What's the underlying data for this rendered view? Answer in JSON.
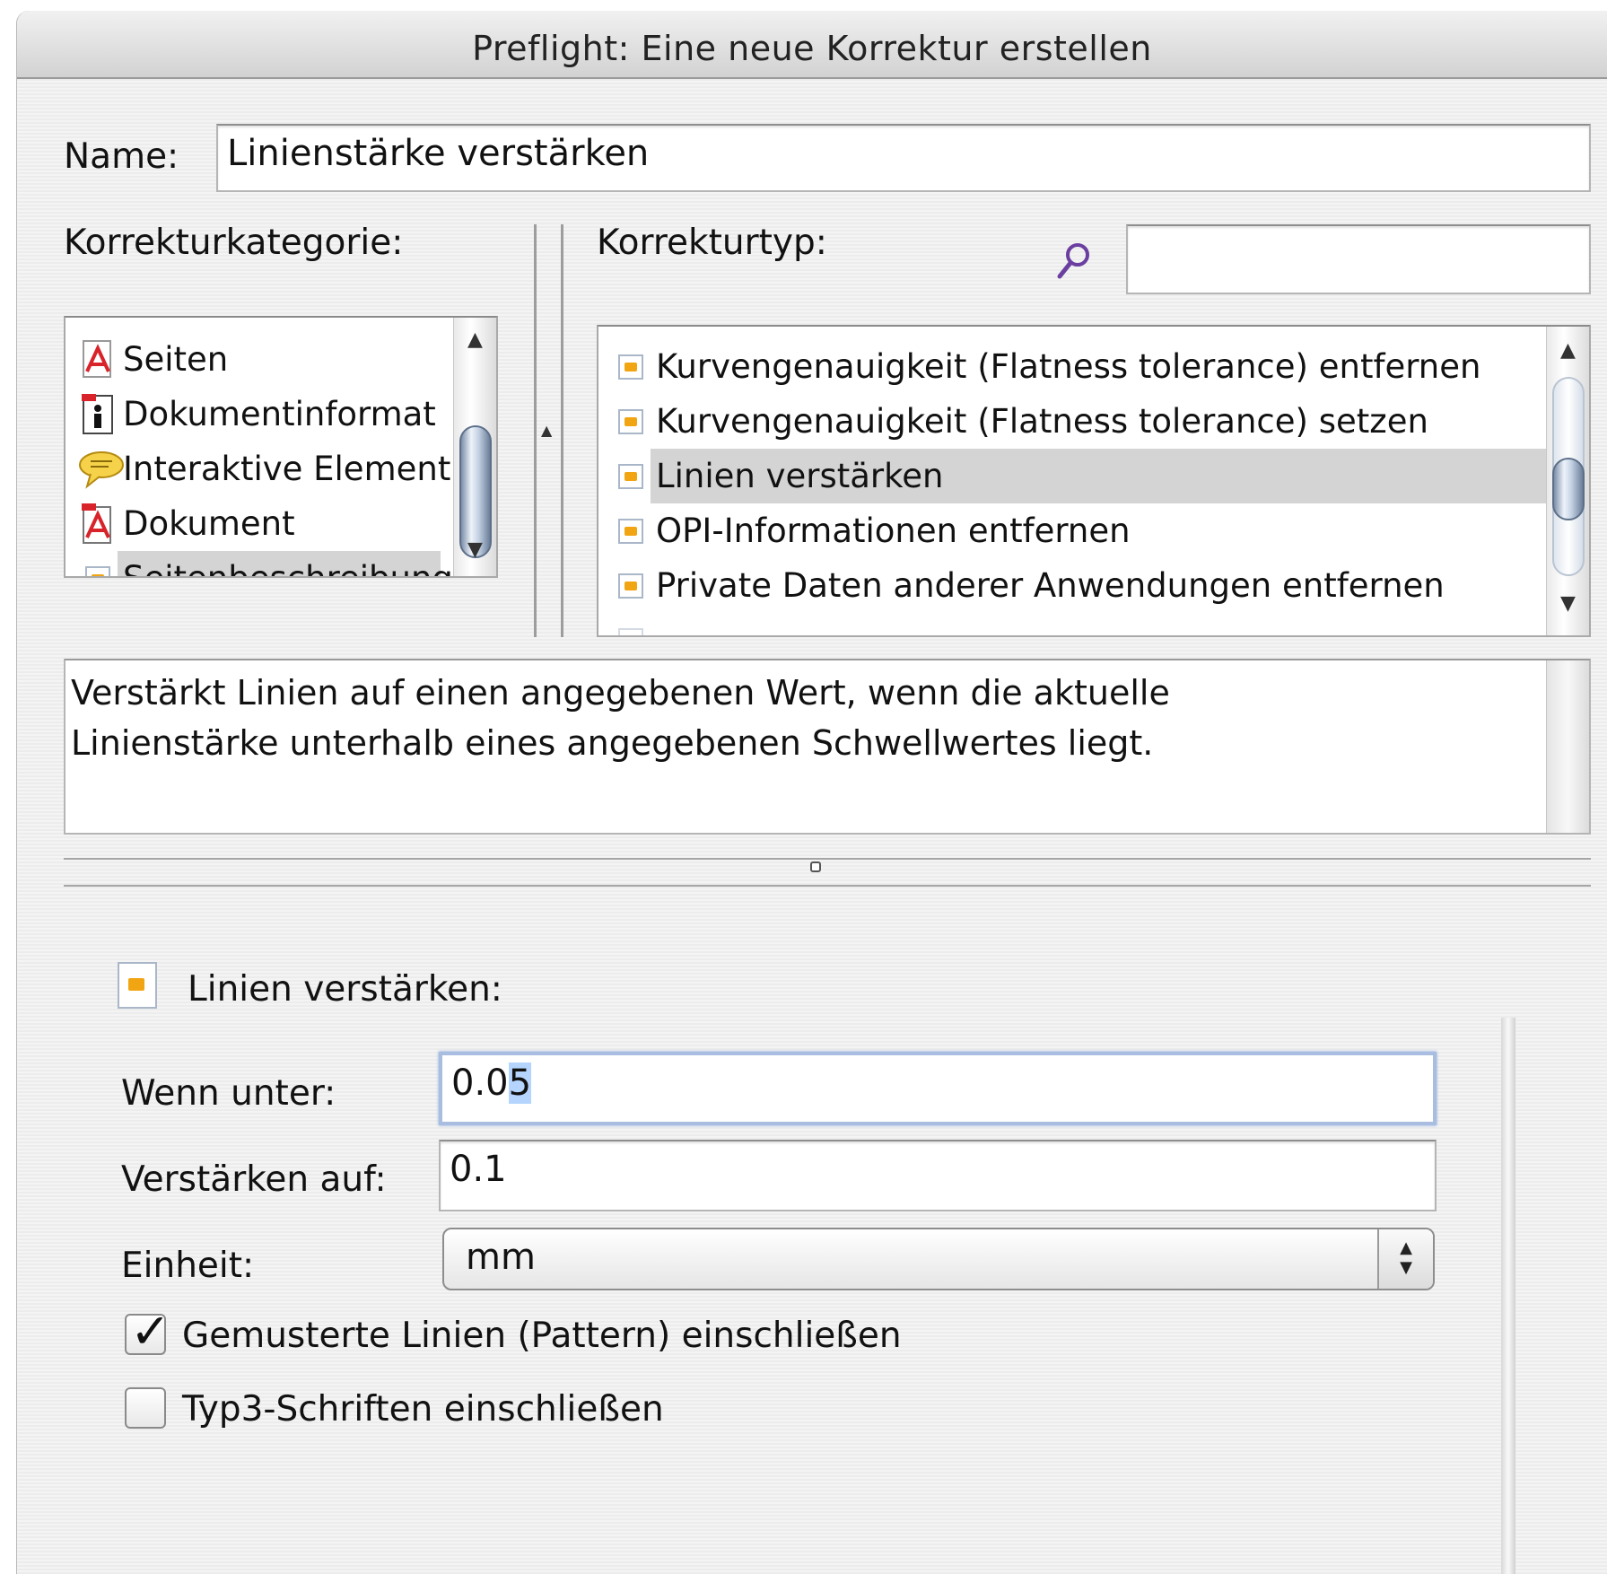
{
  "window": {
    "title": "Preflight: Eine neue Korrektur erstellen"
  },
  "name_field": {
    "label": "Name:",
    "value": "Linienstärke verstärken"
  },
  "category": {
    "label": "Korrekturkategorie:",
    "items": [
      {
        "label": "Seiten",
        "icon": "pdf-icon",
        "selected": false
      },
      {
        "label": "Dokumentinformat",
        "icon": "info-icon",
        "selected": false
      },
      {
        "label": "Interaktive Element",
        "icon": "speech-bubble-icon",
        "selected": false
      },
      {
        "label": "Dokument",
        "icon": "pdf-icon",
        "selected": false
      },
      {
        "label": "Seitenbeschreibung",
        "icon": "fixup-icon",
        "selected": true
      }
    ],
    "scroll_up": "▲",
    "scroll_down": "▼"
  },
  "fixup_type": {
    "label": "Korrekturtyp:",
    "search_value": "",
    "items": [
      {
        "label": "Kurvengenauigkeit (Flatness tolerance) entfernen",
        "selected": false
      },
      {
        "label": "Kurvengenauigkeit (Flatness tolerance) setzen",
        "selected": false
      },
      {
        "label": "Linien verstärken",
        "selected": true
      },
      {
        "label": "OPI-Informationen entfernen",
        "selected": false
      },
      {
        "label": "Private Daten anderer Anwendungen entfernen",
        "selected": false
      }
    ],
    "scroll_up": "▲",
    "scroll_down": "▼"
  },
  "description": {
    "line1": "Verstärkt Linien auf einen angegebenen Wert, wenn die aktuelle",
    "line2": "Linienstärke unterhalb eines angegebenen Schwellwertes liegt."
  },
  "settings": {
    "heading": "Linien verstärken:",
    "if_below": {
      "label": "Wenn unter:",
      "value_prefix": "0.0",
      "value_selected": "5"
    },
    "increase_to": {
      "label": "Verstärken auf:",
      "value": "0.1"
    },
    "unit": {
      "label": "Einheit:",
      "value": "mm",
      "stepper_up": "▲",
      "stepper_down": "▼"
    },
    "checkboxes": [
      {
        "label": "Gemusterte Linien (Pattern) einschließen",
        "checked": true,
        "mark": "✓"
      },
      {
        "label": "Typ3-Schriften einschließen",
        "checked": false,
        "mark": ""
      }
    ]
  },
  "colors": {
    "accent": "#f1a512",
    "selection": "#b5d5ff",
    "list_selection": "#d4d4d4"
  }
}
